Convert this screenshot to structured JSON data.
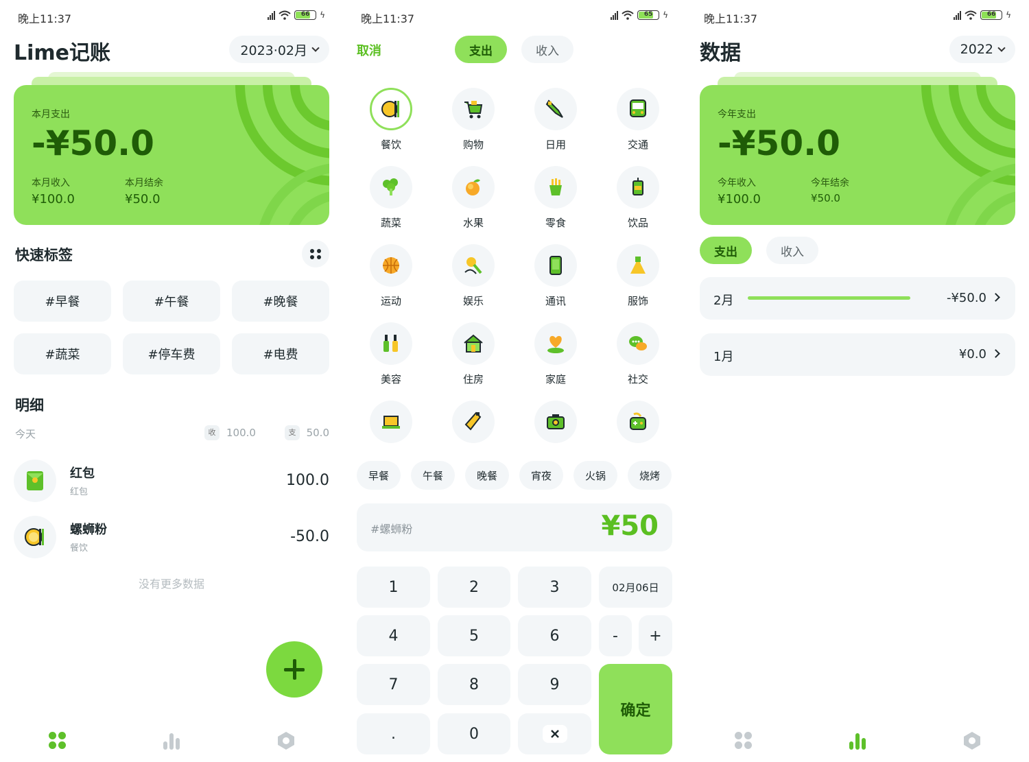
{
  "colors": {
    "brand": "#8fe05a",
    "brand_dark": "#1f5c07",
    "accent_text": "#5bbf22",
    "surface": "#f3f6f8",
    "inactive": "#c5cbcf"
  },
  "status": {
    "time": "晚上11:37",
    "net": "HD",
    "battery_1": "66",
    "battery_2": "65",
    "battery_3": "66"
  },
  "home": {
    "title": "Lime记账",
    "month_picker": "2023·02月",
    "card": {
      "label": "本月支出",
      "amount": "-¥50.0",
      "income_label": "本月收入",
      "income": "¥100.0",
      "balance_label": "本月结余",
      "balance": "¥50.0"
    },
    "quick_tags_title": "快速标签",
    "quick_tags": [
      "#早餐",
      "#午餐",
      "#晚餐",
      "#蔬菜",
      "#停车费",
      "#电费"
    ],
    "detail_title": "明细",
    "day": {
      "label": "今天",
      "in_badge": "收",
      "in": "100.0",
      "out_badge": "支",
      "out": "50.0"
    },
    "records": [
      {
        "title": "红包",
        "sub": "红包",
        "amount": "100.0",
        "icon": "red-envelope-icon"
      },
      {
        "title": "螺蛳粉",
        "sub": "餐饮",
        "amount": "-50.0",
        "icon": "dining-icon"
      }
    ],
    "no_more": "没有更多数据"
  },
  "add": {
    "cancel": "取消",
    "tab_expense": "支出",
    "tab_income": "收入",
    "categories": [
      {
        "name": "餐饮",
        "icon": "dining-icon"
      },
      {
        "name": "购物",
        "icon": "cart-icon"
      },
      {
        "name": "日用",
        "icon": "toothpaste-icon"
      },
      {
        "name": "交通",
        "icon": "bus-icon"
      },
      {
        "name": "蔬菜",
        "icon": "broccoli-icon"
      },
      {
        "name": "水果",
        "icon": "orange-icon"
      },
      {
        "name": "零食",
        "icon": "fries-icon"
      },
      {
        "name": "饮品",
        "icon": "cup-icon"
      },
      {
        "name": "运动",
        "icon": "basketball-icon"
      },
      {
        "name": "娱乐",
        "icon": "microphone-icon"
      },
      {
        "name": "通讯",
        "icon": "phone-icon"
      },
      {
        "name": "服饰",
        "icon": "dress-icon"
      },
      {
        "name": "美容",
        "icon": "nail-polish-icon"
      },
      {
        "name": "住房",
        "icon": "house-icon"
      },
      {
        "name": "家庭",
        "icon": "heart-home-icon"
      },
      {
        "name": "社交",
        "icon": "chat-icon"
      },
      {
        "name": "",
        "icon": "laptop-icon"
      },
      {
        "name": "",
        "icon": "bottle-icon"
      },
      {
        "name": "",
        "icon": "camera-icon"
      },
      {
        "name": "",
        "icon": "gamepad-icon"
      }
    ],
    "quick_tags": [
      "早餐",
      "午餐",
      "晚餐",
      "宵夜",
      "火锅",
      "烧烤"
    ],
    "note_placeholder": "#螺蛳粉",
    "amount": "¥50",
    "keys": [
      "1",
      "2",
      "3",
      "4",
      "5",
      "6",
      "7",
      "8",
      "9",
      ".",
      "0"
    ],
    "date": "02月06日",
    "minus": "-",
    "plus": "+",
    "confirm": "确定"
  },
  "stats": {
    "title": "数据",
    "year_picker": "2022",
    "card": {
      "label": "今年支出",
      "amount": "-¥50.0",
      "income_label": "今年收入",
      "income": "¥100.0",
      "balance_label": "今年结余",
      "balance": "¥50.0"
    },
    "tab_expense": "支出",
    "tab_income": "收入",
    "months": [
      {
        "month": "2月",
        "value": "-¥50.0",
        "ratio": 1.0
      },
      {
        "month": "1月",
        "value": "¥0.0",
        "ratio": 0
      }
    ]
  }
}
